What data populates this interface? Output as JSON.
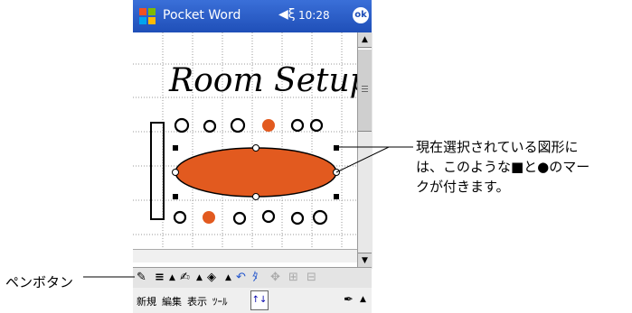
{
  "titlebar": {
    "app_title": "Pocket Word",
    "time": "10:28",
    "ok_label": "ok"
  },
  "document": {
    "handwritten_title": "Room Setup"
  },
  "menubar": {
    "items": [
      "新規",
      "編集",
      "表示",
      "ﾂｰﾙ"
    ]
  },
  "callouts": {
    "selection_note_lines": [
      "現在選択されている図形に",
      "は、このような■と●のマー",
      "クが付きます。"
    ],
    "pen_button_label": "ペンボタン"
  },
  "colors": {
    "titlebar": "#1f4fb8",
    "ellipse_fill": "#e25a1f",
    "grid": "#9a9a9a"
  }
}
